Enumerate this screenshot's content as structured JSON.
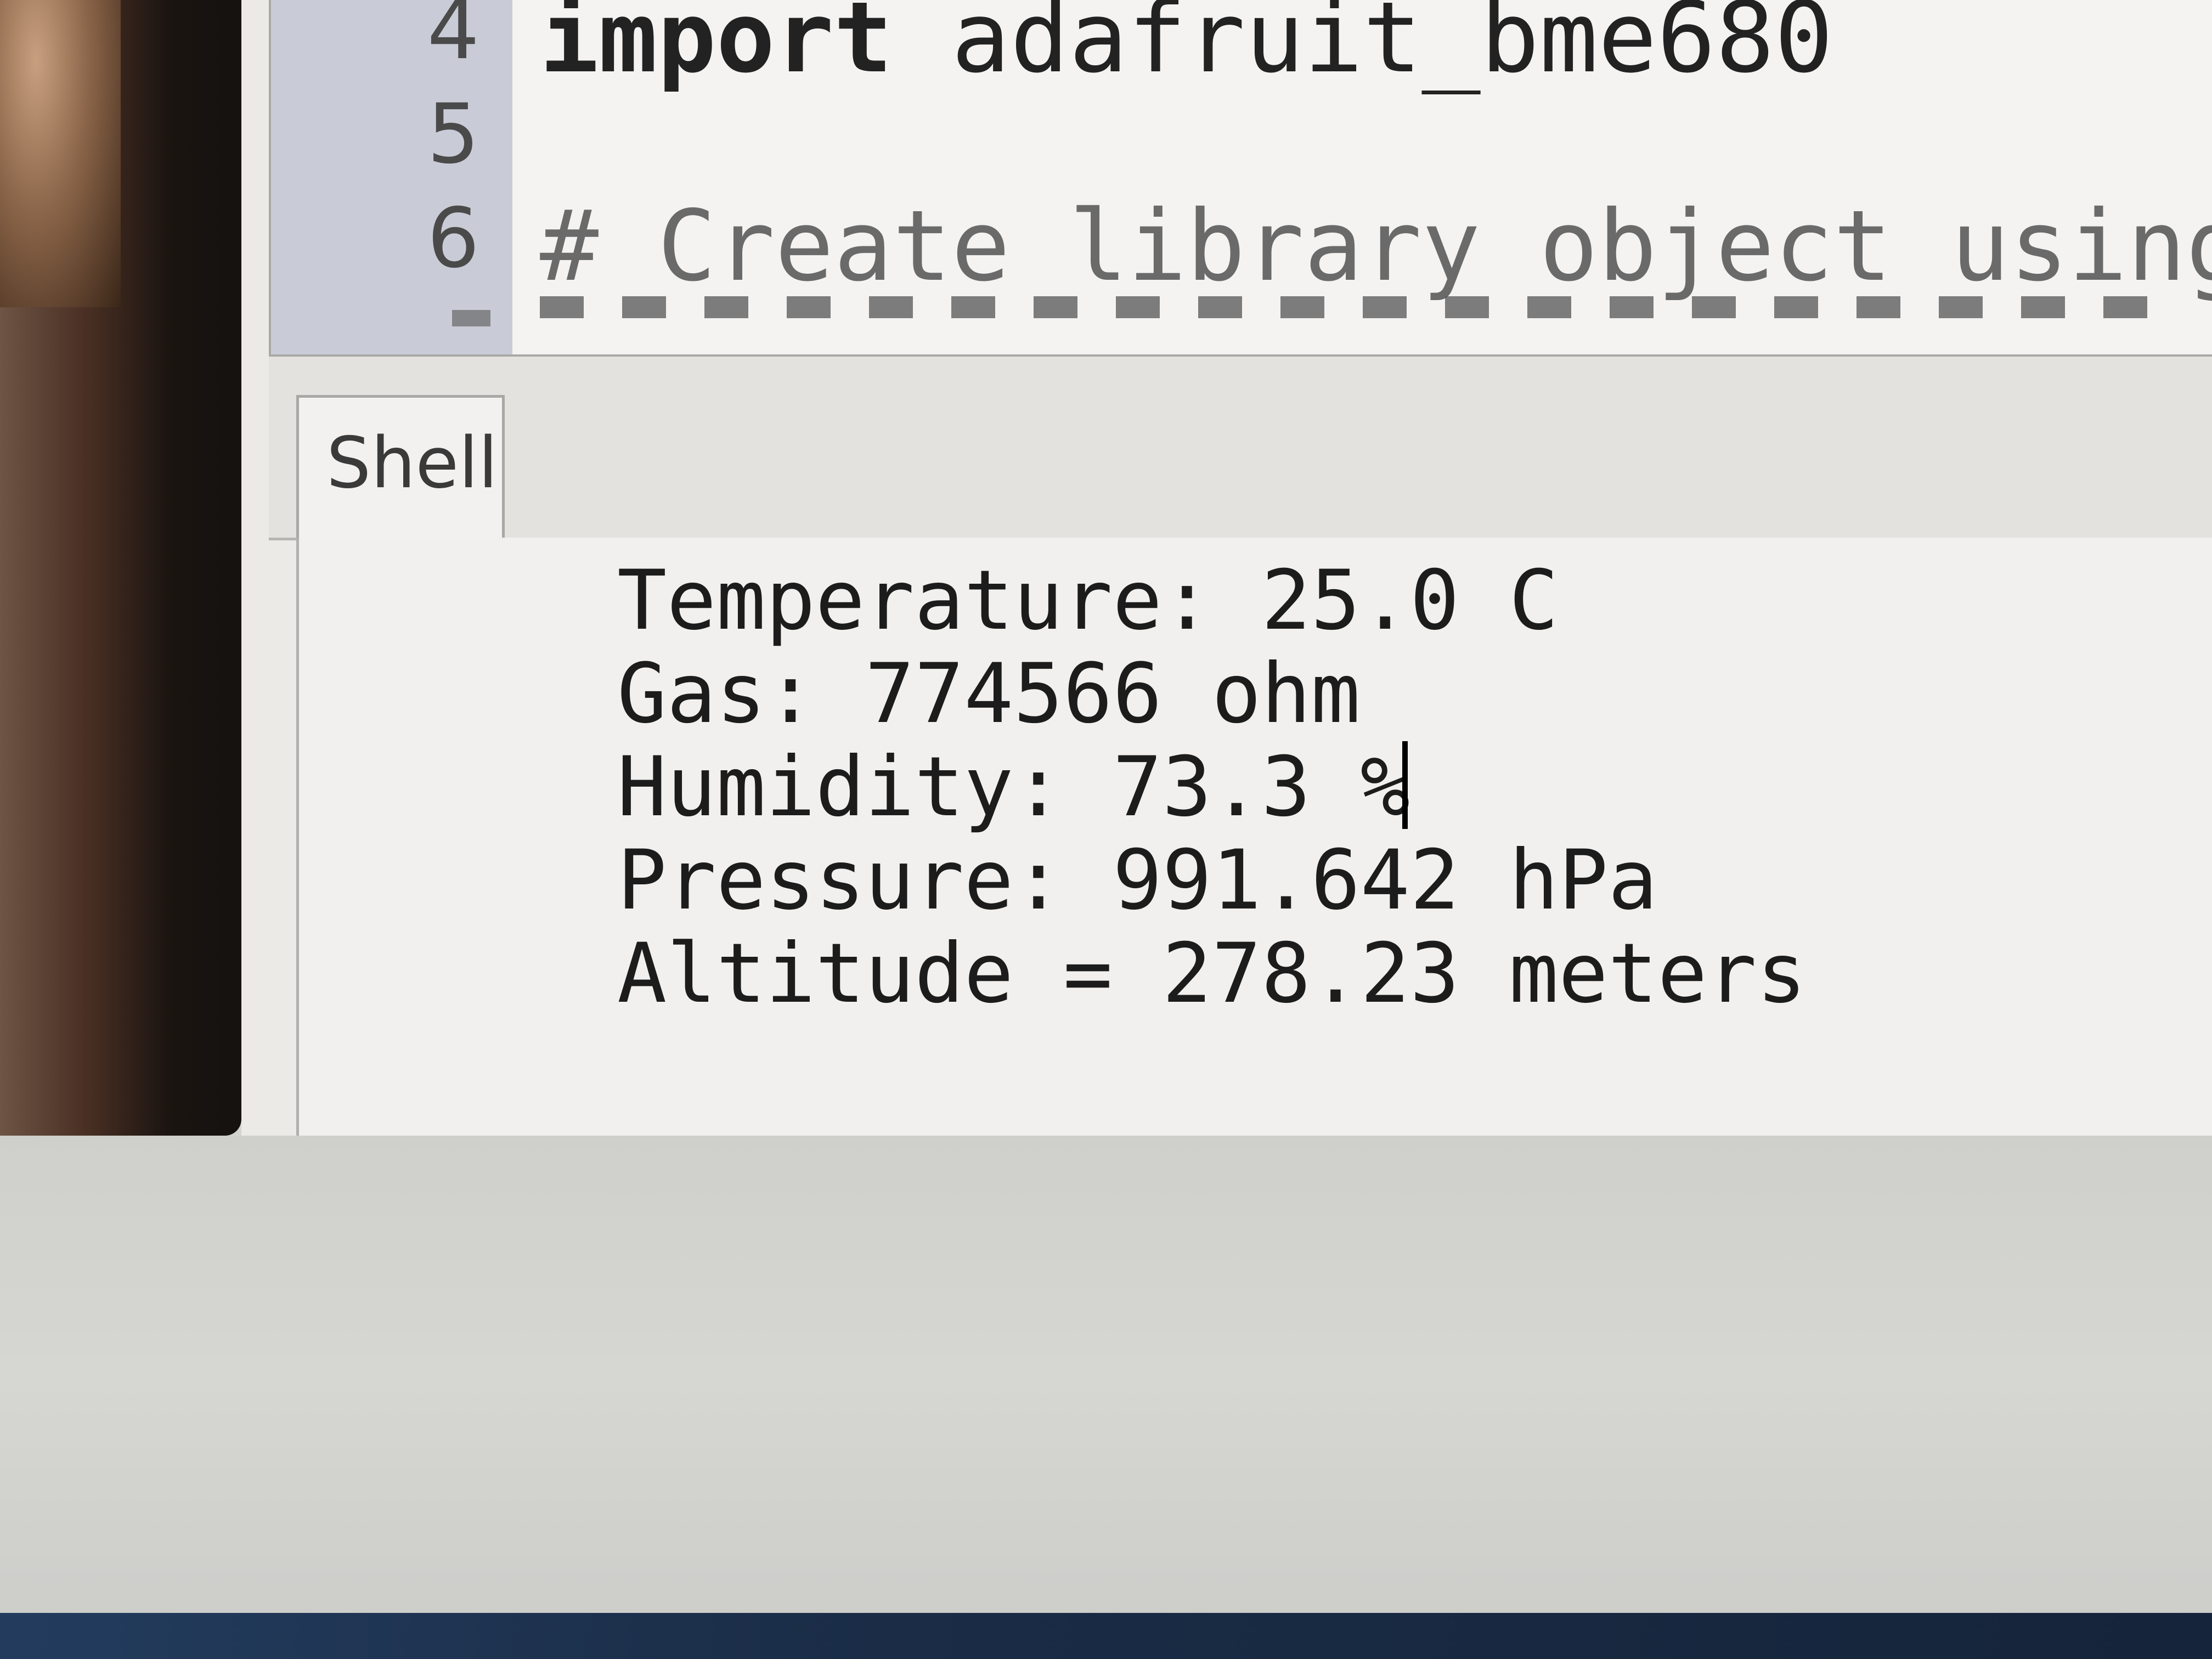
{
  "editor": {
    "lines": [
      {
        "number": "4",
        "keyword": "import",
        "rest": " adafruit_bme680"
      },
      {
        "number": "5",
        "keyword": "",
        "rest": ""
      },
      {
        "number": "6",
        "keyword": "",
        "rest": "# Create library object using our E"
      }
    ]
  },
  "shell": {
    "tab_label": "Shell",
    "output": [
      "Temperature: 25.0 C",
      "Gas: 774566 ohm",
      "Humidity: 73.3 %",
      "Pressure: 991.642 hPa",
      "Altitude = 278.23 meters"
    ]
  }
}
